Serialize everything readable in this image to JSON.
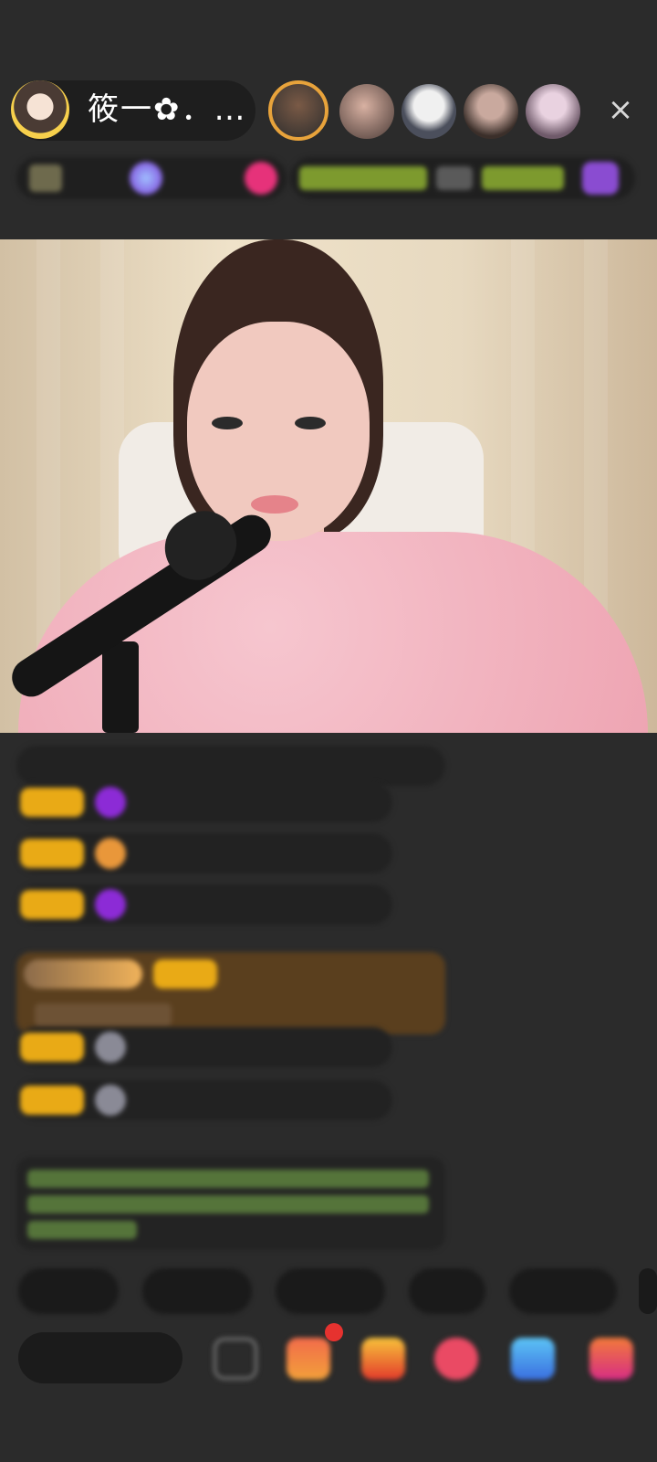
{
  "header": {
    "host_name": "筱一✿．…",
    "close_icon": "×"
  },
  "info_bar": {
    "left_chip_texts": [
      "",
      "",
      ""
    ],
    "right_chip_texts": [
      "",
      "",
      ""
    ]
  },
  "chat": {
    "messages": [
      {
        "badge": "",
        "name": "",
        "text": ""
      },
      {
        "badge": "",
        "name": "",
        "text": ""
      },
      {
        "badge": "",
        "name": "",
        "text": ""
      },
      {
        "badge": "",
        "name": "",
        "text": ""
      },
      {
        "badge": "",
        "name": "",
        "text": ""
      },
      {
        "badge": "",
        "name": "",
        "text": ""
      }
    ],
    "notice": ""
  },
  "quick_replies": [
    "",
    "",
    "",
    "",
    ""
  ],
  "input": {
    "placeholder": ""
  },
  "colors": {
    "background": "#2b2b2b",
    "badge": "#e9aa16",
    "highlight": "#5a3f1e",
    "accent_pink": "#ea4a64"
  },
  "icons": [
    "close-icon",
    "emoji-icon",
    "gift-box-icon",
    "gift-icon",
    "heart-icon",
    "game-icon",
    "more-icon"
  ]
}
